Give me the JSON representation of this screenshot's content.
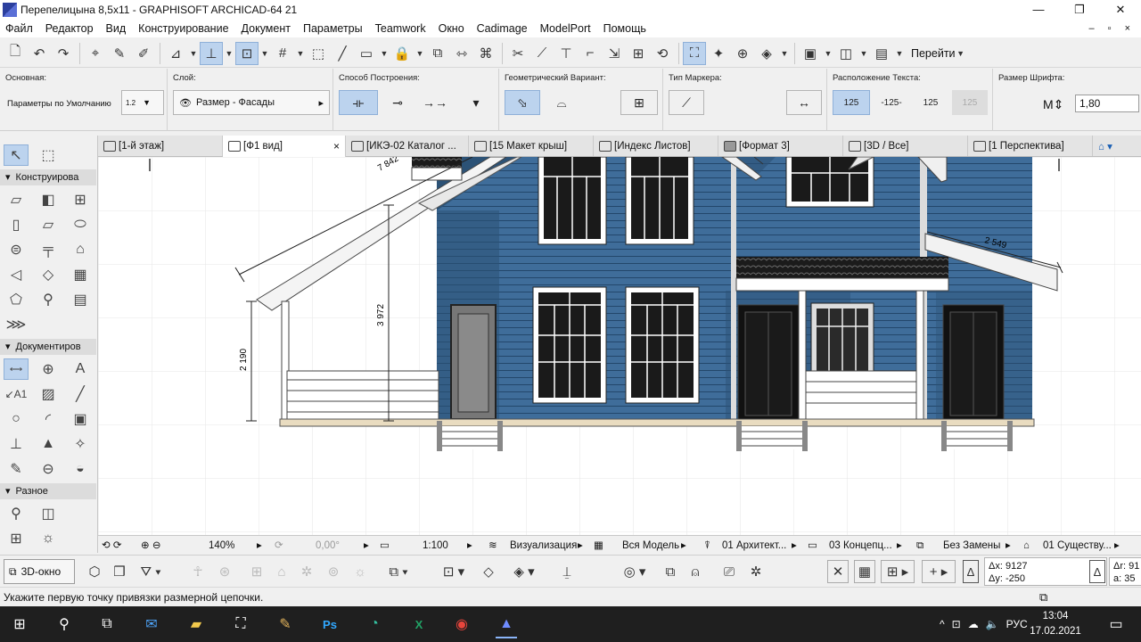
{
  "window": {
    "title": "Перепелицына 8,5x11 - GRAPHISOFT ARCHICAD-64 21",
    "min": "—",
    "max": "❐",
    "close": "✕"
  },
  "menu": [
    "Файл",
    "Редактор",
    "Вид",
    "Конструирование",
    "Документ",
    "Параметры",
    "Teamwork",
    "Окно",
    "Cadimage",
    "ModelPort",
    "Помощь"
  ],
  "mdi_controls": "– ▫ ×",
  "toolbar": {
    "goto_label": "Перейти"
  },
  "infobox": {
    "main_label": "Основная:",
    "defaults_label": "Параметры по Умолчанию",
    "layer_label": "Слой:",
    "layer_value": "Размер - Фасады",
    "construction_label": "Способ Построения:",
    "geometry_label": "Геометрический Вариант:",
    "marker_label": "Тип Маркера:",
    "text_pos_label": "Расположение Текста:",
    "text_pos_opts": [
      "125",
      "-125-",
      "125",
      "125"
    ],
    "font_size_label": "Размер Шрифта:",
    "font_size_value": "1,80",
    "dim_icon_text": "1.2"
  },
  "toolbox": {
    "section_construction": "Конструирова",
    "section_documentation": "Документиров",
    "section_misc": "Разное"
  },
  "tabs": [
    {
      "label": "[1-й этаж]"
    },
    {
      "label": "[Ф1 вид]"
    },
    {
      "label": "[ИКЭ-02 Каталог ..."
    },
    {
      "label": "[15 Макет крыш]"
    },
    {
      "label": "[Индекс Листов]"
    },
    {
      "label": "[Формат 3]"
    },
    {
      "label": "[3D / Все]"
    },
    {
      "label": "[1 Перспектива]"
    }
  ],
  "tab_close": "×",
  "drawing": {
    "dim_roof_slope": "7 842",
    "dim_right_roof": "2 549",
    "dim_height_total": "3 972",
    "dim_height_porch": "2 190"
  },
  "statusnav": {
    "zoom": "140%",
    "angle": "0,00°",
    "scale": "1:100",
    "visualization": "Визуализация",
    "model_view": "Вся Модель",
    "layer_combo": "01 Архитект...",
    "pen_set": "03 Концепц...",
    "override": "Без Замены",
    "renovation": "01 Существу..."
  },
  "bottom": {
    "view3d_label": "3D-окно",
    "coord_dx": "Δx: 9127",
    "coord_dy": "Δy: -250",
    "coord_r": "Δr: 91",
    "coord_a": "a: 35"
  },
  "prompt_text": "Укажите первую точку привязки размерной цепочки.",
  "taskbar": {
    "lang": "РУС",
    "time": "13:04",
    "date": "17.02.2021"
  },
  "colors": {
    "siding": "#3f6d9a",
    "siding_dark": "#2c5276",
    "trim": "#ffffff",
    "accent": "#bcd3ee"
  }
}
